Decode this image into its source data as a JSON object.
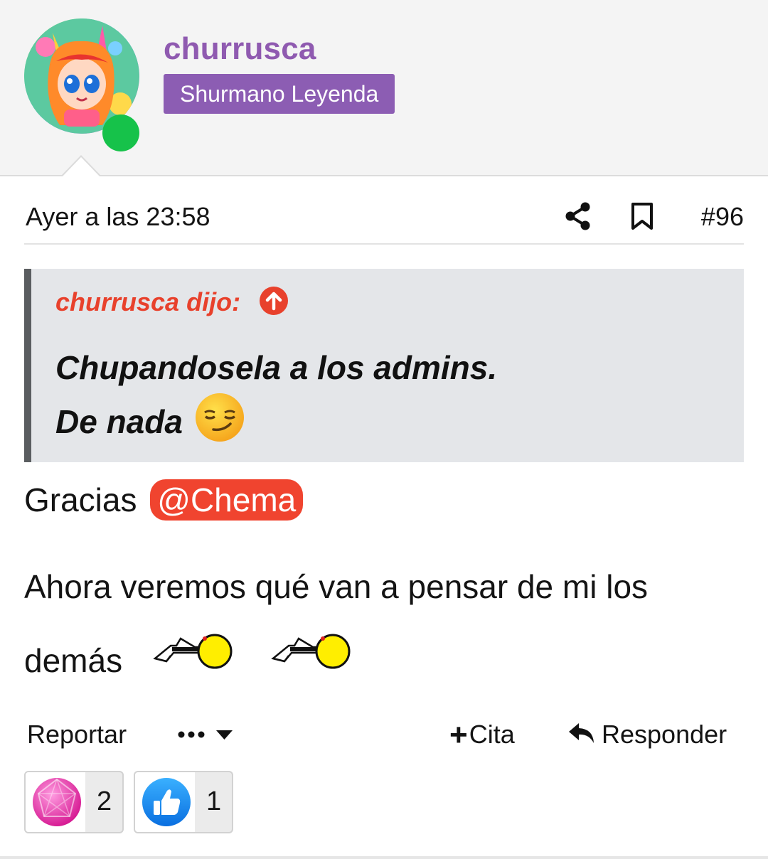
{
  "user": {
    "name": "churrusca",
    "title": "Shurmano Leyenda",
    "online": true,
    "avatar_icon": "cartoon-girl-avatar"
  },
  "post": {
    "time": "Ayer a las 23:58",
    "number": "#96",
    "share_icon": "share-icon",
    "bookmark_icon": "bookmark-icon"
  },
  "quote": {
    "author": "churrusca dijo:",
    "line1": "Chupandosela a los admins.",
    "line2": "De nada",
    "emoji": "smirking-face"
  },
  "body": {
    "gracias": "Gracias",
    "mention": "@Chema",
    "line1": "Ahora veremos qué van a pensar de mi los",
    "line2": "demás",
    "smilies": [
      "smiley-with-gun",
      "smiley-with-gun"
    ]
  },
  "actions": {
    "report": "Reportar",
    "cita": "Cita",
    "reply": "Responder"
  },
  "reactions": [
    {
      "icon": "pink-gem-icon",
      "count": "2"
    },
    {
      "icon": "thumbs-up-icon",
      "count": "1"
    }
  ],
  "colors": {
    "username": "#8f5ab0",
    "title_badge": "#8c5db3",
    "quote_author": "#e8412c",
    "mention": "#f0442f",
    "online": "#16c24a"
  }
}
